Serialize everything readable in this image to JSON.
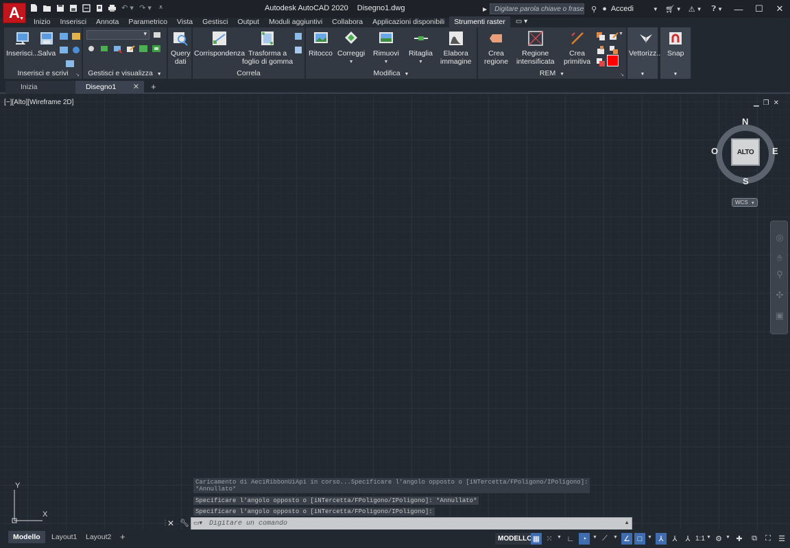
{
  "app": {
    "logo_letter": "A",
    "title": "Autodesk AutoCAD 2020",
    "document_name": "Disegno1.dwg"
  },
  "search": {
    "placeholder": "Digitare parola chiave o frase"
  },
  "signin_label": "Accedi",
  "ribbon_tabs": [
    {
      "label": "Inizio"
    },
    {
      "label": "Inserisci"
    },
    {
      "label": "Annota"
    },
    {
      "label": "Parametrico"
    },
    {
      "label": "Vista"
    },
    {
      "label": "Gestisci"
    },
    {
      "label": "Output"
    },
    {
      "label": "Moduli aggiuntivi"
    },
    {
      "label": "Collabora"
    },
    {
      "label": "Applicazioni disponibili"
    },
    {
      "label": "Strumenti raster"
    }
  ],
  "active_tab": "Strumenti raster",
  "panels": {
    "inserisci_scrivi": {
      "title": "Inserisci e scrivi",
      "buttons": [
        "Inserisci...",
        "Salva"
      ]
    },
    "gestisci_visualizza": {
      "title": "Gestisci e visualizza"
    },
    "query": {
      "label_line1": "Query",
      "label_line2": "dati"
    },
    "correla": {
      "title": "Correla",
      "buttons": [
        {
          "line1": "Corrispondenza",
          "line2": ""
        },
        {
          "line1": "Trasforma a",
          "line2": "foglio di gomma"
        }
      ]
    },
    "modifica": {
      "title": "Modifica",
      "buttons": [
        {
          "line1": "Ritocco",
          "line2": ""
        },
        {
          "line1": "Correggi",
          "line2": ""
        },
        {
          "line1": "Rimuovi",
          "line2": ""
        },
        {
          "line1": "Ritaglia",
          "line2": ""
        },
        {
          "line1": "Elabora",
          "line2": "immagine"
        }
      ]
    },
    "rem": {
      "title": "REM",
      "buttons": [
        {
          "line1": "Crea",
          "line2": "regione"
        },
        {
          "line1": "Regione",
          "line2": "intensificata"
        },
        {
          "line1": "Crea",
          "line2": "primitiva"
        }
      ]
    },
    "vettorizza": {
      "label": "Vettorizz..."
    },
    "snap": {
      "label": "Snap"
    }
  },
  "doc_tabs": [
    {
      "label": "Inizia"
    },
    {
      "label": "Disegno1"
    }
  ],
  "viewport": {
    "label": "[−][Alto][Wireframe 2D]",
    "grid_color": "#2a323d",
    "background": "#212830"
  },
  "viewcube": {
    "face": "ALTO",
    "north": "N",
    "south": "S",
    "east": "E",
    "west": "O",
    "wcs": "WCS"
  },
  "ucs": {
    "x": "X",
    "y": "Y"
  },
  "command": {
    "history": [
      "Caricamento di AeciRibbonUiApi in corso...Specificare l'angolo opposto o [iNTercetta/FPoligono/IPoligono]:",
      "*Annullato*",
      "Specificare l'angolo opposto o [iNTercetta/FPoligono/IPoligono]: *Annullato*",
      "Specificare l'angolo opposto o [iNTercetta/FPoligono/IPoligono]:"
    ],
    "placeholder": "Digitare un comando"
  },
  "layout_tabs": [
    {
      "label": "Modello"
    },
    {
      "label": "Layout1"
    },
    {
      "label": "Layout2"
    }
  ],
  "status": {
    "model_label": "MODELLO",
    "scale": "1:1"
  },
  "colors": {
    "accent_red": "#c3161c",
    "status_active": "#3f6db0"
  }
}
